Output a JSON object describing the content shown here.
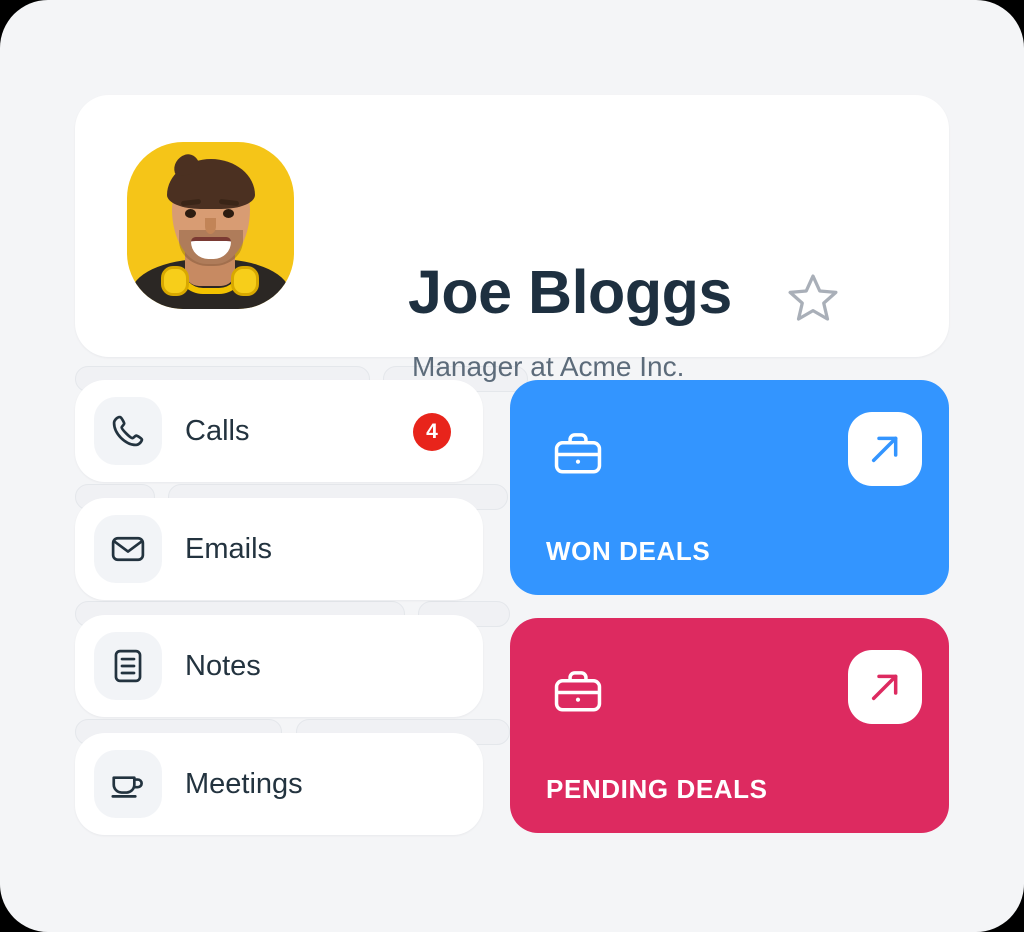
{
  "profile": {
    "name": "Joe Bloggs",
    "subtitle": "Manager at Acme Inc.",
    "avatar_alt": "profile-photo",
    "star_icon": "star-outline-icon",
    "name_color": "#1E3040",
    "subtitle_color": "#5C6B7A"
  },
  "activity_list": [
    {
      "label": "Calls",
      "icon": "phone-icon",
      "badge": "4"
    },
    {
      "label": "Emails",
      "icon": "envelope-icon",
      "badge": null
    },
    {
      "label": "Notes",
      "icon": "document-icon",
      "badge": null
    },
    {
      "label": "Meetings",
      "icon": "coffee-cup-icon",
      "badge": null
    }
  ],
  "deal_cards": [
    {
      "title": "WON DEALS",
      "icon": "briefcase-icon",
      "action_icon": "arrow-up-right-icon",
      "color": "#3395FF"
    },
    {
      "title": "PENDING DEALS",
      "icon": "briefcase-icon",
      "action_icon": "arrow-up-right-icon",
      "color": "#DD2A60"
    }
  ],
  "theme": {
    "page_background": "#F4F5F7",
    "card_background": "#FFFFFF",
    "badge_color": "#E8241B",
    "icon_tile_background": "#F2F4F7",
    "ghost_fill": "#F0F1F4",
    "ghost_border": "#E4E7EB"
  }
}
